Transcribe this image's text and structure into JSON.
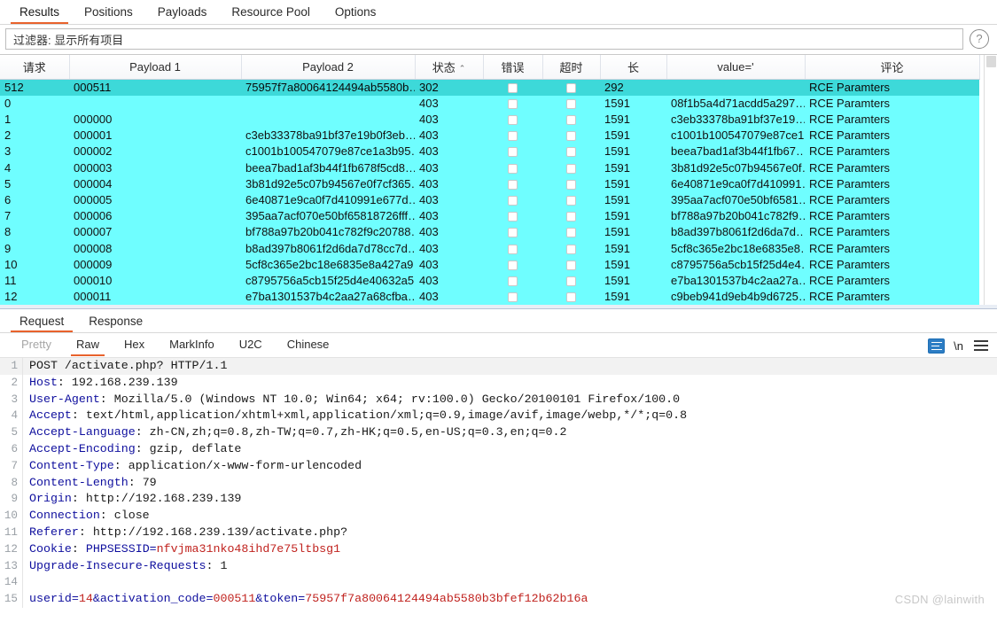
{
  "top_tabs": [
    {
      "label": "Results",
      "active": true
    },
    {
      "label": "Positions",
      "active": false
    },
    {
      "label": "Payloads",
      "active": false
    },
    {
      "label": "Resource Pool",
      "active": false
    },
    {
      "label": "Options",
      "active": false
    }
  ],
  "filter": {
    "text": "过滤器: 显示所有项目",
    "help_icon": "question-mark-icon"
  },
  "results_table": {
    "columns": [
      {
        "key": "request",
        "label": "请求"
      },
      {
        "key": "payload1",
        "label": "Payload 1"
      },
      {
        "key": "payload2",
        "label": "Payload 2"
      },
      {
        "key": "status",
        "label": "状态",
        "sort": "^"
      },
      {
        "key": "error",
        "label": "错误"
      },
      {
        "key": "timeout",
        "label": "超时"
      },
      {
        "key": "length",
        "label": "长"
      },
      {
        "key": "value",
        "label": "value='"
      },
      {
        "key": "comment",
        "label": "评论"
      }
    ],
    "rows": [
      {
        "request": "512",
        "payload1": "000511",
        "payload2": "75957f7a80064124494ab5580b…",
        "status": "302",
        "length": "292",
        "value": "",
        "comment": "RCE Paramters",
        "selected": true
      },
      {
        "request": "0",
        "payload1": "",
        "payload2": "",
        "status": "403",
        "length": "1591",
        "value": "08f1b5a4d71acdd5a297…",
        "comment": "RCE Paramters",
        "selected": false
      },
      {
        "request": "1",
        "payload1": "000000",
        "payload2": "",
        "status": "403",
        "length": "1591",
        "value": "c3eb33378ba91bf37e19…",
        "comment": "RCE Paramters",
        "selected": false
      },
      {
        "request": "2",
        "payload1": "000001",
        "payload2": "c3eb33378ba91bf37e19b0f3eb…",
        "status": "403",
        "length": "1591",
        "value": "c1001b100547079e87ce1…",
        "comment": "RCE Paramters",
        "selected": false
      },
      {
        "request": "3",
        "payload1": "000002",
        "payload2": "c1001b100547079e87ce1a3b95…",
        "status": "403",
        "length": "1591",
        "value": "beea7bad1af3b44f1fb67…",
        "comment": "RCE Paramters",
        "selected": false
      },
      {
        "request": "4",
        "payload1": "000003",
        "payload2": "beea7bad1af3b44f1fb678f5cd8…",
        "status": "403",
        "length": "1591",
        "value": "3b81d92e5c07b94567e0f…",
        "comment": "RCE Paramters",
        "selected": false
      },
      {
        "request": "5",
        "payload1": "000004",
        "payload2": "3b81d92e5c07b94567e0f7cf365…",
        "status": "403",
        "length": "1591",
        "value": "6e40871e9ca0f7d410991…",
        "comment": "RCE Paramters",
        "selected": false
      },
      {
        "request": "6",
        "payload1": "000005",
        "payload2": "6e40871e9ca0f7d410991e677d…",
        "status": "403",
        "length": "1591",
        "value": "395aa7acf070e50bf6581…",
        "comment": "RCE Paramters",
        "selected": false
      },
      {
        "request": "7",
        "payload1": "000006",
        "payload2": "395aa7acf070e50bf65818726fff…",
        "status": "403",
        "length": "1591",
        "value": "bf788a97b20b041c782f9…",
        "comment": "RCE Paramters",
        "selected": false
      },
      {
        "request": "8",
        "payload1": "000007",
        "payload2": "bf788a97b20b041c782f9c20788…",
        "status": "403",
        "length": "1591",
        "value": "b8ad397b8061f2d6da7d…",
        "comment": "RCE Paramters",
        "selected": false
      },
      {
        "request": "9",
        "payload1": "000008",
        "payload2": "b8ad397b8061f2d6da7d78cc7d…",
        "status": "403",
        "length": "1591",
        "value": "5cf8c365e2bc18e6835e8…",
        "comment": "RCE Paramters",
        "selected": false
      },
      {
        "request": "10",
        "payload1": "000009",
        "payload2": "5cf8c365e2bc18e6835e8a427a9…",
        "status": "403",
        "length": "1591",
        "value": "c8795756a5cb15f25d4e4…",
        "comment": "RCE Paramters",
        "selected": false
      },
      {
        "request": "11",
        "payload1": "000010",
        "payload2": "c8795756a5cb15f25d4e40632a5…",
        "status": "403",
        "length": "1591",
        "value": "e7ba1301537b4c2aa27a…",
        "comment": "RCE Paramters",
        "selected": false
      },
      {
        "request": "12",
        "payload1": "000011",
        "payload2": "e7ba1301537b4c2aa27a68cfba…",
        "status": "403",
        "length": "1591",
        "value": "c9beb941d9eb4b9d6725…",
        "comment": "RCE Paramters",
        "selected": false
      }
    ]
  },
  "message_tabs": [
    {
      "label": "Request",
      "active": true
    },
    {
      "label": "Response",
      "active": false
    }
  ],
  "view_tabs": [
    {
      "label": "Pretty",
      "active": false,
      "muted": true
    },
    {
      "label": "Raw",
      "active": true,
      "muted": false
    },
    {
      "label": "Hex",
      "active": false,
      "muted": false
    },
    {
      "label": "MarkInfo",
      "active": false,
      "muted": false
    },
    {
      "label": "U2C",
      "active": false,
      "muted": false
    },
    {
      "label": "Chinese",
      "active": false,
      "muted": false
    }
  ],
  "view_actions": {
    "wrap_icon": "word-wrap-icon",
    "newline_label": "\\n",
    "menu_icon": "hamburger-menu-icon"
  },
  "request": {
    "lines": [
      {
        "n": "1",
        "key": "",
        "sep": "",
        "value": "POST /activate.php? HTTP/1.1",
        "style": "plain"
      },
      {
        "n": "2",
        "key": "Host",
        "sep": ": ",
        "value": "192.168.239.139",
        "style": "header"
      },
      {
        "n": "3",
        "key": "User-Agent",
        "sep": ": ",
        "value": "Mozilla/5.0 (Windows NT 10.0; Win64; x64; rv:100.0) Gecko/20100101 Firefox/100.0",
        "style": "header"
      },
      {
        "n": "4",
        "key": "Accept",
        "sep": ": ",
        "value": "text/html,application/xhtml+xml,application/xml;q=0.9,image/avif,image/webp,*/*;q=0.8",
        "style": "header"
      },
      {
        "n": "5",
        "key": "Accept-Language",
        "sep": ": ",
        "value": "zh-CN,zh;q=0.8,zh-TW;q=0.7,zh-HK;q=0.5,en-US;q=0.3,en;q=0.2",
        "style": "header"
      },
      {
        "n": "6",
        "key": "Accept-Encoding",
        "sep": ": ",
        "value": "gzip, deflate",
        "style": "header"
      },
      {
        "n": "7",
        "key": "Content-Type",
        "sep": ": ",
        "value": "application/x-www-form-urlencoded",
        "style": "header"
      },
      {
        "n": "8",
        "key": "Content-Length",
        "sep": ": ",
        "value": "79",
        "style": "header"
      },
      {
        "n": "9",
        "key": "Origin",
        "sep": ": ",
        "value": "http://192.168.239.139",
        "style": "header"
      },
      {
        "n": "10",
        "key": "Connection",
        "sep": ": ",
        "value": "close",
        "style": "header"
      },
      {
        "n": "11",
        "key": "Referer",
        "sep": ": ",
        "value": "http://192.168.239.139/activate.php?",
        "style": "header"
      },
      {
        "n": "12",
        "key": "Cookie",
        "sep": ": ",
        "value": "PHPSESSID=nfvjma31nko48ihd7e75ltbsg1",
        "style": "cookie"
      },
      {
        "n": "13",
        "key": "Upgrade-Insecure-Requests",
        "sep": ": ",
        "value": "1",
        "style": "header"
      },
      {
        "n": "14",
        "key": "",
        "sep": "",
        "value": "",
        "style": "plain"
      },
      {
        "n": "15",
        "key": "",
        "sep": "",
        "value": "userid=14&activation_code=000511&token=75957f7a80064124494ab5580b3bfef12b62b16a",
        "style": "body"
      }
    ]
  },
  "watermark": "CSDN @lainwith",
  "colors": {
    "accent": "#e8622c",
    "row_normal": "#6ffeff",
    "row_selected": "#3dd9d9",
    "header_key": "#0f0f9e",
    "value_red": "#c0221e"
  }
}
